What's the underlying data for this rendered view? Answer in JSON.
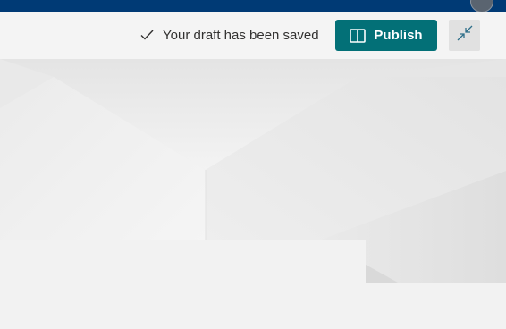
{
  "header": {
    "status_text": "Your draft has been saved",
    "status_icon": "checkmark-icon",
    "publish_label": "Publish",
    "publish_icon": "book-open-icon",
    "collapse_icon": "collapse-arrows-icon"
  },
  "colors": {
    "topbar": "#003a75",
    "accent": "#037077",
    "toolbar_bg": "#f4f4f4",
    "page_bg": "#f2f2f2"
  }
}
